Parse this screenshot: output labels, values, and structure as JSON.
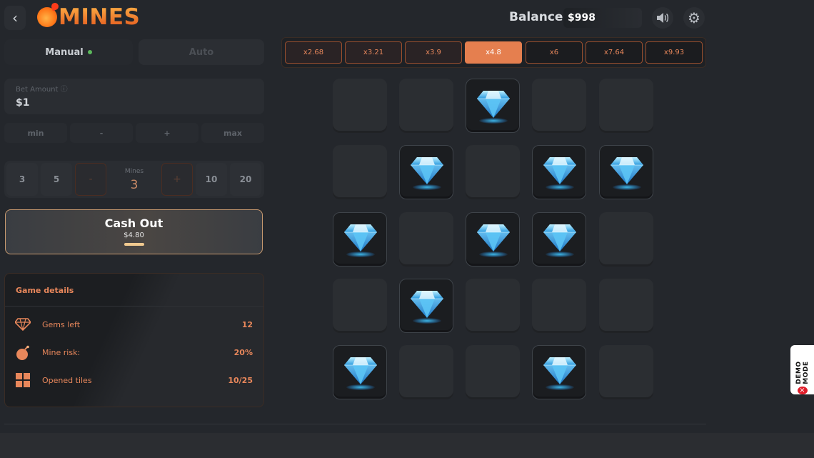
{
  "header": {
    "logo_text": "MINES",
    "balance_label": "Balance:",
    "balance_value": "$998"
  },
  "tabs": {
    "manual": "Manual",
    "auto": "Auto"
  },
  "bet": {
    "label": "Bet Amount ⓘ",
    "value": "$1",
    "buttons": [
      "min",
      "-",
      "+",
      "max"
    ]
  },
  "mines": {
    "options_left": [
      "3",
      "5"
    ],
    "options_right": [
      "10",
      "20"
    ],
    "decrement": "-",
    "increment": "+",
    "label": "Mines",
    "value": "3"
  },
  "cashout": {
    "label": "Cash Out",
    "amount": "$4.80"
  },
  "details": {
    "title": "Game details",
    "rows": [
      {
        "label": "Gems left",
        "value": "12",
        "icon": "gem-icon"
      },
      {
        "label": "Mine risk:",
        "value": "20%",
        "icon": "bomb-icon"
      },
      {
        "label": "Opened tiles",
        "value": "10/25",
        "icon": "grid-icon"
      }
    ]
  },
  "multipliers": [
    "x2.68",
    "x3.21",
    "x3.9",
    "x4.8",
    "x6",
    "x7.64",
    "x9.93"
  ],
  "active_multiplier_index": 3,
  "grid": [
    [
      0,
      0,
      1,
      0,
      0
    ],
    [
      0,
      1,
      0,
      1,
      1
    ],
    [
      1,
      0,
      1,
      1,
      0
    ],
    [
      0,
      1,
      0,
      0,
      0
    ],
    [
      1,
      0,
      0,
      1,
      0
    ]
  ],
  "demo_badge": "DEMO MODE",
  "colors": {
    "accent": "#e57f4f",
    "accent_text": "#e8875b",
    "gem": "#3fb6f0"
  }
}
